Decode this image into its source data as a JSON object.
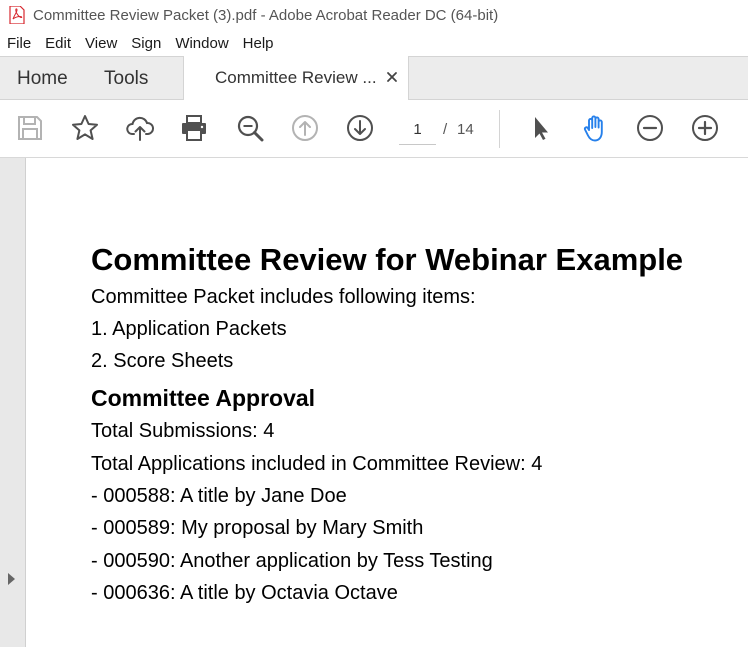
{
  "window": {
    "title": "Committee Review Packet (3).pdf - Adobe Acrobat Reader DC (64-bit)",
    "app_icon": "pdf-icon",
    "accent_color": "#d7282f"
  },
  "menu": {
    "items": [
      "File",
      "Edit",
      "View",
      "Sign",
      "Window",
      "Help"
    ]
  },
  "tabs": {
    "home": "Home",
    "tools": "Tools",
    "document": "Committee Review ...",
    "close_icon": "close-icon"
  },
  "toolbar": {
    "icons": [
      "save-icon",
      "bookmark-star-icon",
      "upload-cloud-icon",
      "print-icon",
      "zoom-search-icon",
      "previous-page-icon",
      "next-page-icon",
      "select-cursor-icon",
      "hand-tool-icon",
      "zoom-out-icon",
      "zoom-in-icon"
    ],
    "current_page": "1",
    "page_separator": "/",
    "total_pages": "14",
    "active_tool_color": "#2680eb"
  },
  "document": {
    "title": "Committee Review for Webinar Example",
    "intro": "Committee Packet includes following items:",
    "items": [
      "1. Application Packets",
      "2. Score Sheets"
    ],
    "approval_heading": "Committee Approval",
    "total_submissions": "Total Submissions: 4",
    "total_applications": "Total Applications included in Committee Review: 4",
    "applications": [
      "- 000588: A title by Jane Doe",
      "- 000589: My proposal by Mary Smith",
      "- 000590: Another application by Tess Testing",
      "- 000636: A title by Octavia Octave"
    ]
  }
}
